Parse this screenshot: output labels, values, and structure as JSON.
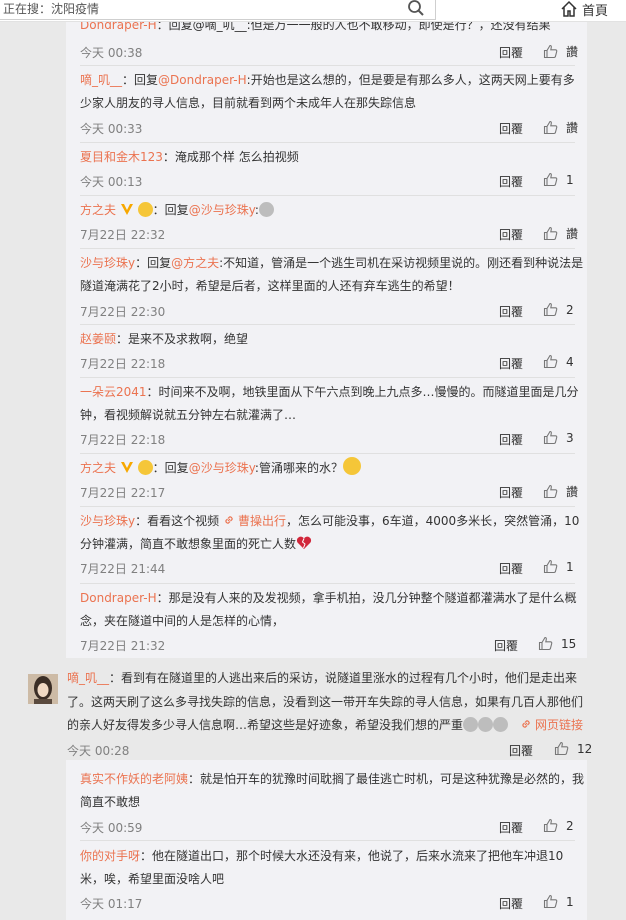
{
  "search": {
    "placeholder": "正在搜：沈阳疫情",
    "icon": "search-icon"
  },
  "nav": {
    "home_label": "首頁",
    "icon": "home-icon"
  },
  "actions": {
    "reply": "回覆",
    "reply_alt": "回覆"
  },
  "top_comments": [
    {
      "user": "Dondraper-H",
      "text_prefix": "：回复@嘀_叽__:但是万一一般的人也不敢移动，即使是行？，还没有结果",
      "time": "今天 00:38",
      "likes": "讚"
    },
    {
      "user": "嘀_叽__",
      "mention_prefix": "：回复",
      "mention": "@Dondraper-H",
      "text": ":开始也是这么想的，但是要是有那么多人，这两天网上要有多少家人朋友的寻人信息，目前就看到两个未成年人在那失踪信息",
      "time": "今天 00:33",
      "likes": "讚"
    },
    {
      "user": "夏目和金木123",
      "text": "：淹成那个样 怎么拍视频",
      "time": "今天 00:13",
      "likes": "1"
    },
    {
      "user": "方之夫",
      "mention_prefix": "：回复",
      "mention": "@沙与珍珠y",
      "text": ":",
      "time": "7月22日 22:32",
      "likes": "讚"
    },
    {
      "user": "沙与珍珠y",
      "mention_prefix": "：回复",
      "mention": "@方之夫",
      "text": ":不知道，管涌是一个逃生司机在采访视频里说的。刚还看到种说法是隧道淹满花了2小时，希望是后者，这样里面的人还有弃车逃生的希望！",
      "time": "7月22日 22:30",
      "likes": "2"
    },
    {
      "user": "赵姜颐",
      "text": "：是来不及求救啊，绝望",
      "time": "7月22日 22:18",
      "likes": "4"
    },
    {
      "user": "一朵云2041",
      "text": "：时间来不及啊，地铁里面从下午六点到晚上九点多…慢慢的。而隧道里面是几分钟，看视频解说就五分钟左右就灌满了…",
      "time": "7月22日 22:18",
      "likes": "3"
    },
    {
      "user": "方之夫",
      "mention_prefix": "：回复",
      "mention": "@沙与珍珠y",
      "text": ":管涌哪来的水？",
      "time": "7月22日 22:17",
      "likes": "讚"
    },
    {
      "user": "沙与珍珠y",
      "text_a": "：看看这个视频 ",
      "link": "曹操出行",
      "text_b": "，怎么可能没事，6车道，4000多米长，突然管涌，10分钟灌满，简直不敢想象里面的死亡人数",
      "time": "7月22日 21:44",
      "likes": "1"
    },
    {
      "user": "Dondraper-H",
      "text": "：那是没有人来的及发视频，拿手机拍，没几分钟整个隧道都灌满水了是什么概念，夹在隧道中间的人是怎样的心情，",
      "time": "7月22日 21:32",
      "likes": "15"
    }
  ],
  "main_comment": {
    "user": "嘀_叽__",
    "text": "：看到有在隧道里的人逃出来后的采访，说隧道里涨水的过程有几个小时，他们是走出来了。这两天刷了这么多寻找失踪的信息，没看到这一带开车失踪的寻人信息，如果有几百人那他们的亲人好友得发多少寻人信息啊…希望这些是好迹象，希望没我们想的严重",
    "link": "网页链接",
    "time": "今天 00:28",
    "likes": "12"
  },
  "sub_comments": [
    {
      "user": "真实不作妖的老阿姨",
      "text": "：就是怕开车的犹豫时间耽搁了最佳逃亡时机，可是这种犹豫是必然的，我简直不敢想",
      "time": "今天 00:59",
      "likes": "2"
    },
    {
      "user": "你的对手呀",
      "text": "：他在隧道出口，那个时候大水还没有来，他说了，后来水流来了把他车冲退10米，唉，希望里面没啥人吧",
      "time": "今天 01:17",
      "likes": "1"
    }
  ],
  "colors": {
    "username": "#eb7350",
    "panel": "#f2f2f5",
    "page": "#e9e9e9"
  }
}
